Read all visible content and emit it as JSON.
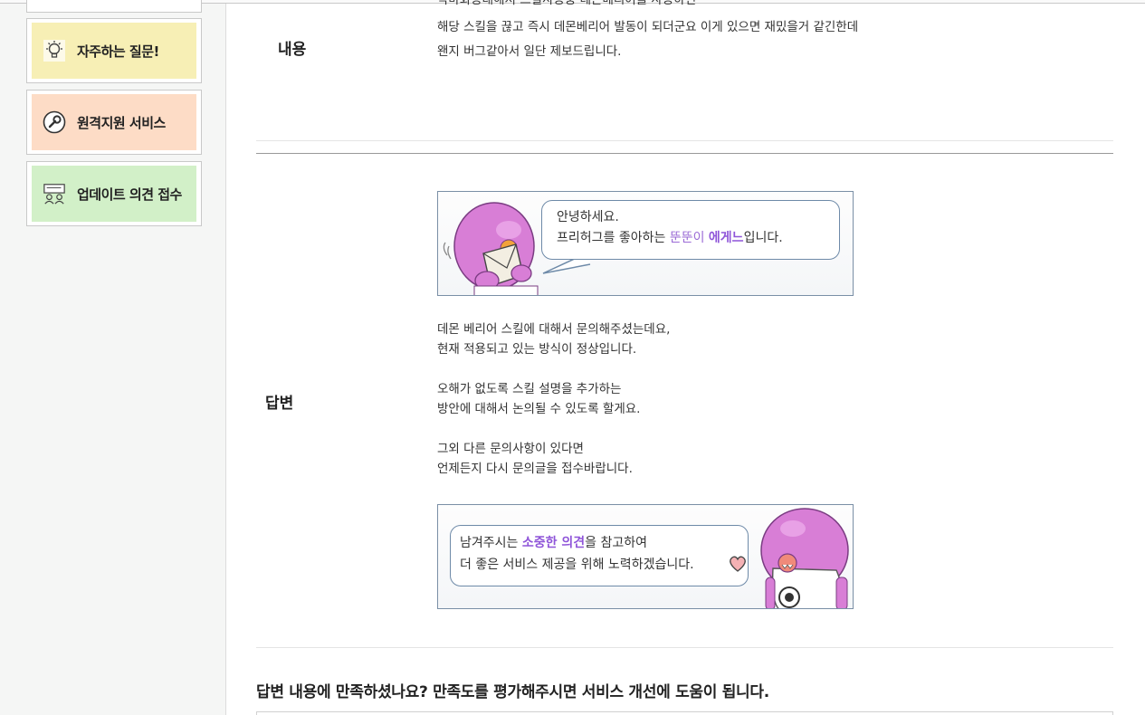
{
  "sidebar": {
    "items": [
      {
        "label": "자주하는 질문!",
        "icon": "lightbulb-icon",
        "color": "#f7efb5"
      },
      {
        "label": "원격지원 서비스",
        "icon": "wrench-icon",
        "color": "#fddcc6"
      },
      {
        "label": "업데이트 의견 접수",
        "icon": "update-board-icon",
        "color": "#d2f0c8"
      }
    ]
  },
  "content": {
    "label": "내용",
    "lines_cut": "악마화등대해서 스킬사용중 데몬베리어를 사용하면",
    "line1": "해당 스킬을 끊고 즉시 데몬베리어 발동이 되더군요 이게 있으면 재밌을거 같긴한데",
    "line2": "왠지 버그같아서 일단 제보드립니다."
  },
  "answer": {
    "label": "답변",
    "banner_top": {
      "greeting": "안녕하세요.",
      "intro_prefix": "프리허그를 좋아하는 ",
      "intro_name1": "뚠뚠이",
      "intro_space": " ",
      "intro_name2": "에게느",
      "intro_suffix": "입니다."
    },
    "paragraphs": [
      "데몬 베리어 스킬에 대해서 문의해주셨는데요,\n현재 적용되고 있는 방식이 정상입니다.",
      "오해가 없도록 스킬 설명을 추가하는\n방안에 대해서 논의될 수 있도록 할게요.",
      "그외 다른 문의사항이 있다면\n언제든지 다시 문의글을 접수바랍니다."
    ],
    "banner_bottom": {
      "line1_prefix": "남겨주시는 ",
      "line1_highlight": "소중한 의견",
      "line1_suffix": "을 참고하여",
      "line2": "더 좋은 서비스 제공을 위해 노력하겠습니다."
    }
  },
  "rating": {
    "question": "답변 내용에 만족하셨나요? 만족도를 평가해주시면 서비스 개선에 도움이 됩니다."
  },
  "colors": {
    "character_pink": "#d87ed6",
    "highlight_purple": "#8f55d9",
    "bubble_border": "#6e8aa8"
  }
}
